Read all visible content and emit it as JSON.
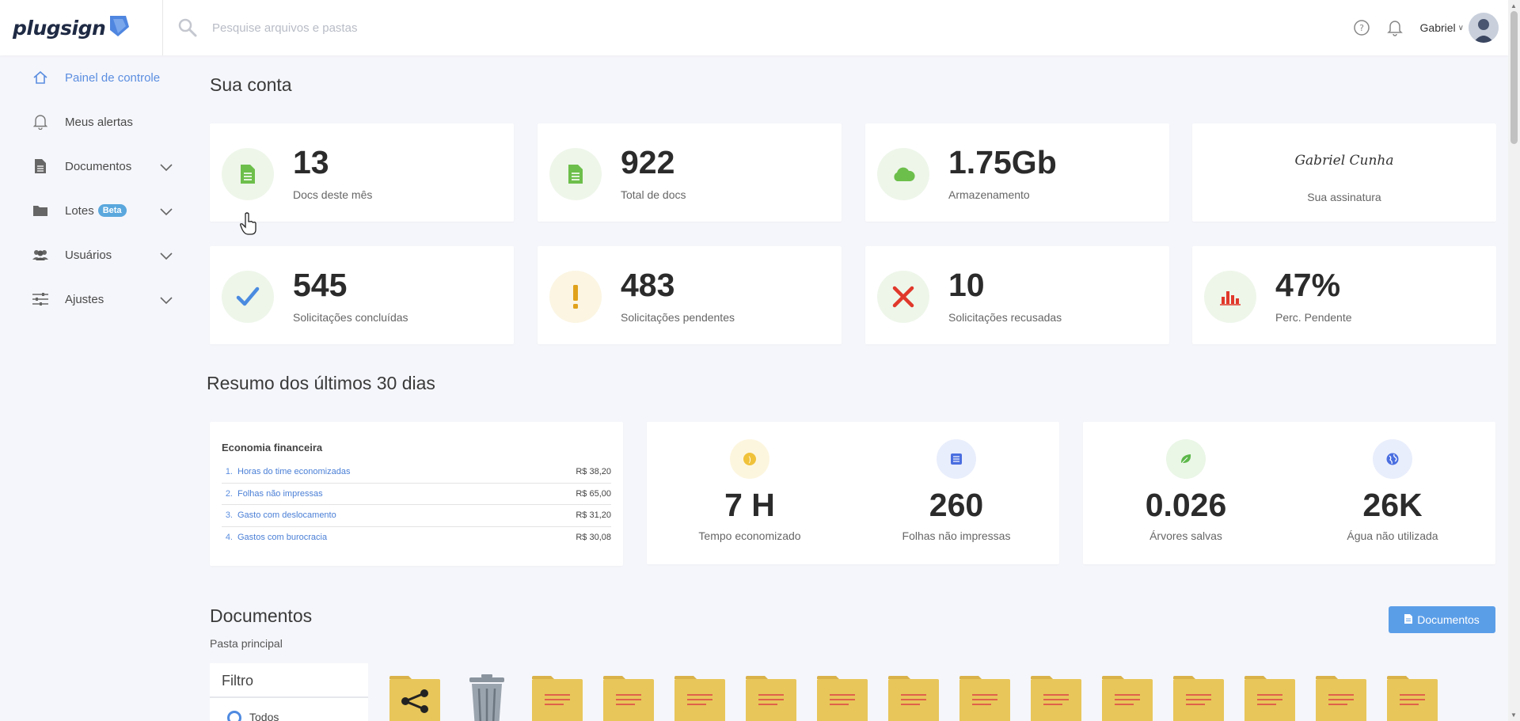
{
  "header": {
    "logo_text": "plugsign",
    "search_placeholder": "Pesquise arquivos e pastas",
    "user_name": "Gabriel",
    "icons": [
      "help-icon",
      "bell-icon",
      "chevron-down-icon",
      "avatar"
    ]
  },
  "sidebar": {
    "items": [
      {
        "label": "Painel de controle",
        "icon": "home-icon",
        "active": true
      },
      {
        "label": "Meus alertas",
        "icon": "bell-icon"
      },
      {
        "label": "Documentos",
        "icon": "document-icon",
        "expandable": true
      },
      {
        "label": "Lotes",
        "icon": "folder-icon",
        "badge": "Beta",
        "expandable": true
      },
      {
        "label": "Usuários",
        "icon": "users-icon",
        "expandable": true
      },
      {
        "label": "Ajustes",
        "icon": "sliders-icon",
        "expandable": true
      }
    ]
  },
  "account": {
    "title": "Sua conta",
    "stats": [
      {
        "value": "13",
        "label": "Docs deste mês",
        "icon": "document-icon"
      },
      {
        "value": "922",
        "label": "Total de docs",
        "icon": "document-icon"
      },
      {
        "value": "1.75Gb",
        "label": "Armazenamento",
        "icon": "cloud-icon"
      },
      {
        "signature": "Gabriel Cunha",
        "label": "Sua assinatura"
      },
      {
        "value": "545",
        "label": "Solicitações concluídas",
        "icon": "check-icon"
      },
      {
        "value": "483",
        "label": "Solicitações pendentes",
        "icon": "exclamation-icon"
      },
      {
        "value": "10",
        "label": "Solicitações recusadas",
        "icon": "x-icon"
      },
      {
        "value": "47%",
        "label": "Perc. Pendente",
        "icon": "bar-chart-icon"
      }
    ]
  },
  "summary": {
    "title": "Resumo dos últimos 30 dias",
    "economy": {
      "title": "Economia financeira",
      "items": [
        {
          "num": "1.",
          "name": "Horas do time economizadas",
          "value": "R$ 38,20"
        },
        {
          "num": "2.",
          "name": "Folhas não impressas",
          "value": "R$ 65,00"
        },
        {
          "num": "3.",
          "name": "Gasto com deslocamento",
          "value": "R$ 31,20"
        },
        {
          "num": "4.",
          "name": "Gastos com burocracia",
          "value": "R$ 30,08"
        }
      ]
    },
    "metrics": [
      {
        "value": "7 H",
        "label": "Tempo economizado",
        "icon": "coin-icon"
      },
      {
        "value": "260",
        "label": "Folhas não impressas",
        "icon": "paper-icon"
      },
      {
        "value": "0.026",
        "label": "Árvores salvas",
        "icon": "leaf-icon"
      },
      {
        "value": "26K",
        "label": "Água não utilizada",
        "icon": "globe-icon"
      }
    ]
  },
  "documents": {
    "title": "Documentos",
    "subtitle": "Pasta principal",
    "button_label": "Documentos",
    "filter_title": "Filtro",
    "filter_option": "Todos"
  },
  "colors": {
    "accent": "#5b9ee8",
    "link": "#4a7fd6",
    "folder": "#e8c65a",
    "folder_tab": "#d9b24a",
    "folder_lines": "#e0624a"
  }
}
